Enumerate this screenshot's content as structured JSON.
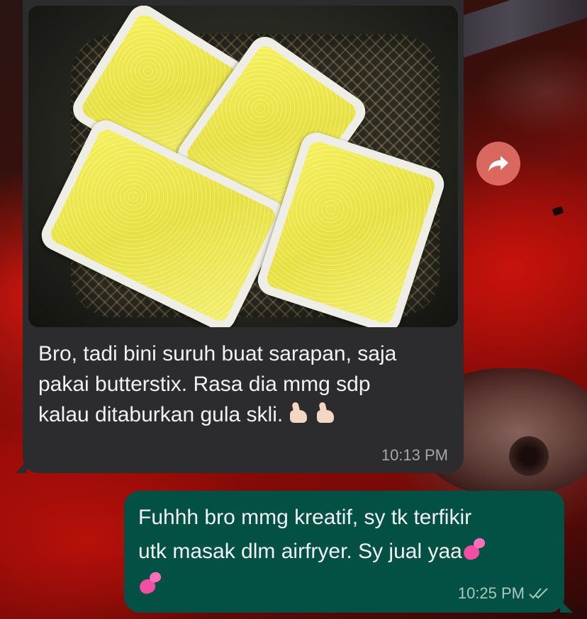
{
  "chat": {
    "incoming": {
      "text_line1": "Bro, tadi bini suruh buat sarapan, saja",
      "text_line2": "pakai butterstix. Rasa dia mmg sdp",
      "text_line3": "kalau ditaburkan gula skli.",
      "time": "10:13 PM",
      "emoji": [
        "thumbs-up",
        "thumbs-up"
      ]
    },
    "outgoing": {
      "text_line1": "Fuhhh bro mmg kreatif, sy tk terfikir",
      "text_line2": "utk masak dlm airfryer. Sy jual yaa",
      "time": "10:25 PM",
      "status_icon": "double-check-icon",
      "emoji": [
        "two-hearts",
        "two-hearts"
      ]
    }
  },
  "colors": {
    "incoming_bubble": "#2c2c2e",
    "outgoing_bubble": "#025144",
    "timestamp": "#a6a6aa"
  }
}
